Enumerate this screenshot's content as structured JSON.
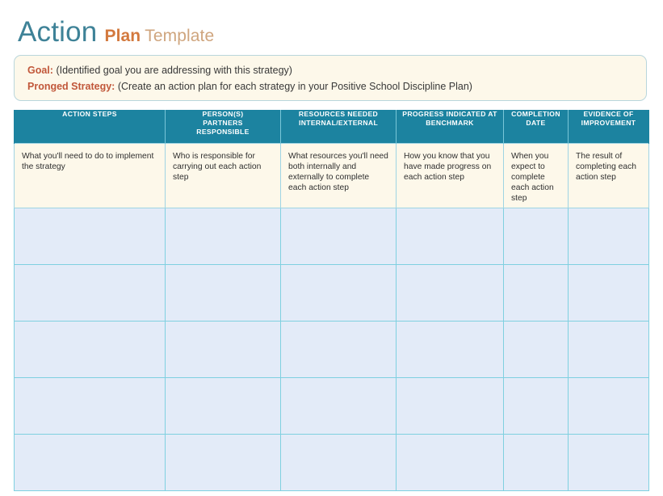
{
  "title": {
    "action": "Action",
    "plan": "Plan",
    "template": "Template",
    "colors": {
      "action": "#3e8297",
      "plan": "#d3793e",
      "template": "#cfa57e"
    }
  },
  "goal_box": {
    "goal_label": "Goal:",
    "goal_text": "(Identified goal you are addressing with this strategy)",
    "strategy_label": "Pronged Strategy:",
    "strategy_text": "(Create an action plan for each strategy in your Positive School Discipline Plan)",
    "label_color": "#c1573a",
    "background": "#fdf8ea",
    "border_color": "#b9d6dc"
  },
  "table": {
    "header_background": "#1c83a0",
    "header_text_color": "#ffffff",
    "instruction_row_background": "#fdf8ea",
    "empty_row_background": "#e3ebf8",
    "grid_line_color": "#7fd0e0",
    "headers": [
      "ACTION STEPS",
      "PERSON(S)\nPARTNERS\nRESPONSIBLE",
      "RESOURCES NEEDED\nINTERNAL/EXTERNAL",
      "PROGRESS INDICATED AT\nBENCHMARK",
      "COMPLETION\nDATE",
      "EVIDENCE OF\nIMPROVEMENT"
    ],
    "instruction_row": [
      "What you'll need to do to implement the strategy",
      "Who is responsible for carrying out each action step",
      "What resources you'll need both internally and externally to complete each action step",
      "How you know that you have made progress on each action step",
      "When you expect to complete each action step",
      "The result of completing each action step"
    ],
    "empty_row_count": 5,
    "column_count": 6
  }
}
